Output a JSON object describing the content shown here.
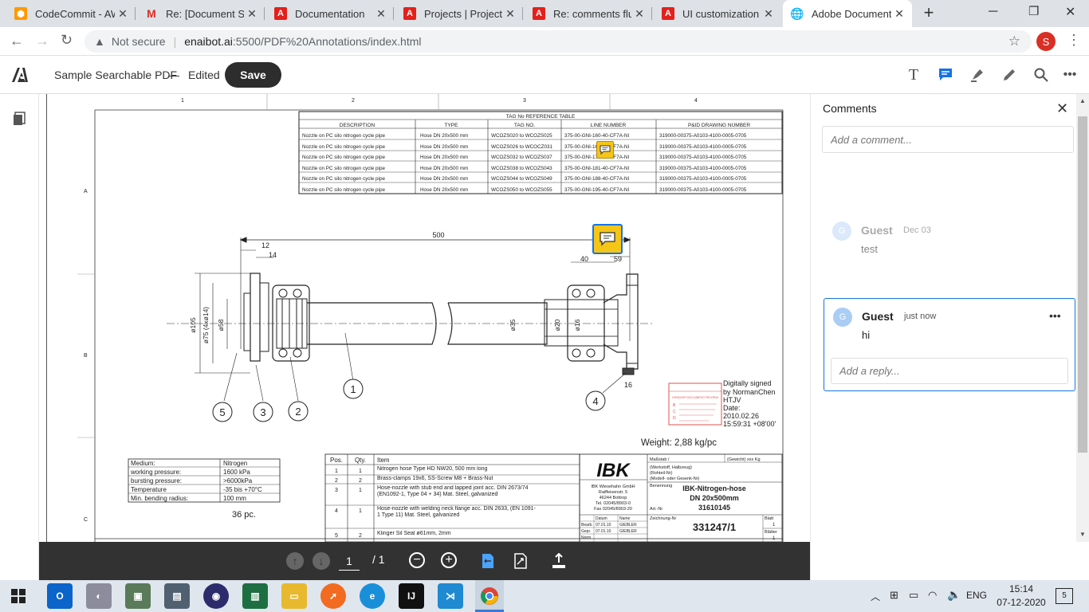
{
  "browser": {
    "tabs": [
      {
        "title": "CodeCommit - AW",
        "icon": "aws-codecommit-icon",
        "color": "#ff9900"
      },
      {
        "title": "Re: [Document Ser",
        "icon": "gmail-icon",
        "color": "#d93025"
      },
      {
        "title": "Documentation",
        "icon": "adobe-icon",
        "color": "#d00"
      },
      {
        "title": "Projects | Project 1",
        "icon": "adobe-icon",
        "color": "#d00"
      },
      {
        "title": "Re: comments flus",
        "icon": "adobe-icon",
        "color": "#d00"
      },
      {
        "title": "UI customization -",
        "icon": "adobe-icon",
        "color": "#d00"
      },
      {
        "title": "Adobe Document",
        "icon": "globe-icon",
        "color": "#5f6368",
        "active": true
      }
    ],
    "new_tab": "+",
    "security": "Not secure",
    "url_host": "enaibot.ai",
    "url_path": ":5500/PDF%20Annotations/index.html",
    "profile_initial": "S"
  },
  "viewer": {
    "file_name": "Sample Searchable PDF",
    "dash": "—",
    "status": "Edited",
    "save_label": "Save"
  },
  "drawing": {
    "table_title": "TAG No REFERENCE TABLE",
    "headers": [
      "DESCRIPTION",
      "TYPE",
      "TAG NO.",
      "LINE NUMBER",
      "P&ID DRAWING NUMBER"
    ],
    "rows": [
      [
        "Nozzle on PC silo nitrogen cycle pipe",
        "Hose DN 20x500 mm",
        "WCOZS020 to WCOZS025",
        "375-00-GNI-160-40-CF7A-NI",
        "319000-00375-A0103-4100-0005-0705"
      ],
      [
        "Nozzle on PC silo nitrogen cycle pipe",
        "Hose DN 20x500 mm",
        "WCOZS026 to WCOCZ031",
        "375-00-GNI-167-40-CF7A-NI",
        "319000-00375-A0103-4100-0005-0705"
      ],
      [
        "Nozzle on PC silo nitrogen cycle pipe",
        "Hose DN 20x500 mm",
        "WCOZS032 to WCOZS037",
        "375-00-GNI-174-40-CF7A-NI",
        "319000-00375-A0103-4100-0005-0705"
      ],
      [
        "Nozzle on PC silo nitrogen cycle pipe",
        "Hose DN 20x500 mm",
        "WCOZS038 to WCOZS043",
        "375-00-GNI-181-40-CF7A-NI",
        "319000-00375-A0103-4100-0005-0705"
      ],
      [
        "Nozzle on PC silo nitrogen cycle pipe",
        "Hose DN 20x500 mm",
        "WCOZS044 to WCOZS049",
        "375-00-GNI-188-40-CF7A-NI",
        "319000-00375-A0103-4100-0005-0705"
      ],
      [
        "Nozzle on PC silo nitrogen cycle pipe",
        "Hose DN 20x500 mm",
        "WCOZS050 to WCOZS055",
        "375-00-GNI-195-40-CF7A-NI",
        "319000-00375-A0103-4100-0005-0705"
      ]
    ],
    "ruler_top": [
      "1",
      "2",
      "3",
      "4"
    ],
    "ruler_left": [
      "A",
      "B",
      "C"
    ],
    "dims": {
      "d500": "500",
      "d12": "12",
      "d14": "14",
      "d40": "40",
      "d59": "59",
      "d16": "16",
      "o105": "ø105",
      "o75": "ø75 (4xø14)",
      "o58": "ø58",
      "o35": "ø35",
      "o20": "ø20",
      "o16": "ø16"
    },
    "balloons": [
      "1",
      "2",
      "3",
      "4",
      "5"
    ],
    "signature": [
      "Digitally signed",
      "by NormanChen",
      "HTJV",
      "Date:",
      "2010.02.26",
      "15:59:31 +08'00'"
    ],
    "stamp_lines": [
      "VENDOR DOCUMENT REVIEW",
      "B",
      "C",
      "D"
    ],
    "weight": "Weight:  2,88 kg/pc",
    "spec": [
      [
        "Medium:",
        "Nitrogen"
      ],
      [
        "working pressure:",
        "1600 kPa"
      ],
      [
        "bursting pressure:",
        ">6000kPa"
      ],
      [
        "Temperature",
        "-35 bis +70°C"
      ],
      [
        "Min. bending radius:",
        "100 mm"
      ]
    ],
    "qty_note": "36  pc.",
    "parts_headers": [
      "Pos.",
      "Qty.",
      "Item"
    ],
    "parts": [
      [
        "1",
        "1",
        "Nitrogen hose Type HD NW20, 500 mm long"
      ],
      [
        "2",
        "2",
        "Brass-clamps 19x6, SS-Screw M8 + Brass-Nut"
      ],
      [
        "3",
        "1",
        "Hose-nozzle with stub end and lapped joint acc. DIN 2673/74 (EN1092-1, Type 04 + 34) Mat. Steel, galvanized"
      ],
      [
        "4",
        "1",
        "Hose-nozzle with welding neck flange acc. DIN 2633, (EN 1091-1 Type 11) Mat. Steel, galvanized"
      ],
      [
        "5",
        "2",
        "Klinger Sil Seal ø61mm, 2mm"
      ]
    ],
    "logo": "IBK",
    "company": [
      "IBK Wiesehahn GmbH",
      "Raiffeisenstr. 5",
      "46244 Bottrop",
      "Tel. 02045/8903-0",
      "Fax 02045/8903-20"
    ],
    "tb_headers": [
      "Maßstab /",
      "(Gewicht) xxx Kg"
    ],
    "tb_material": [
      "(Werkstoff, Halbzeug)",
      "(Rohteil-Nr)",
      "(Modell- oder Gesenk-Nr)"
    ],
    "tb_benennung": "Benennung",
    "tb_title": [
      "IBK-Nitrogen-hose",
      "DN 20x500mm",
      "31610145"
    ],
    "tb_artnr": "Art.-Nr",
    "tb_zeichnung": "Zeichnung-Nr",
    "tb_number": "331247/1",
    "tb_blatt": "Blatt",
    "tb_blatt_val": "1",
    "tb_blatter": "Blätter",
    "tb_blatter_val": "1",
    "tb_rows": [
      [
        "",
        "Datum",
        "Name"
      ],
      [
        "Bearb.",
        "07.01.10",
        "GIEBLER"
      ],
      [
        "Gepr.",
        "07.01.10",
        "GIEBLER"
      ],
      [
        "Norm",
        "",
        ""
      ]
    ]
  },
  "comments": {
    "title": "Comments",
    "add_placeholder": "Add a comment...",
    "threads": [
      {
        "avatar": "G",
        "author": "Guest",
        "time": "Dec 03",
        "text": "test"
      },
      {
        "avatar": "G",
        "author": "Guest",
        "time": "just now",
        "text": "hi",
        "more": "•••",
        "reply_placeholder": "Add a reply..."
      }
    ]
  },
  "pagenav": {
    "current": "1",
    "total": "/ 1"
  },
  "taskbar": {
    "lang": "ENG",
    "time": "15:14",
    "date": "07-12-2020",
    "notifications": "5"
  },
  "colors": {
    "accent": "#1473e6",
    "sticky": "#f5c518",
    "save_bg": "#2d2d2d",
    "tab_bg": "#dee1e6"
  }
}
